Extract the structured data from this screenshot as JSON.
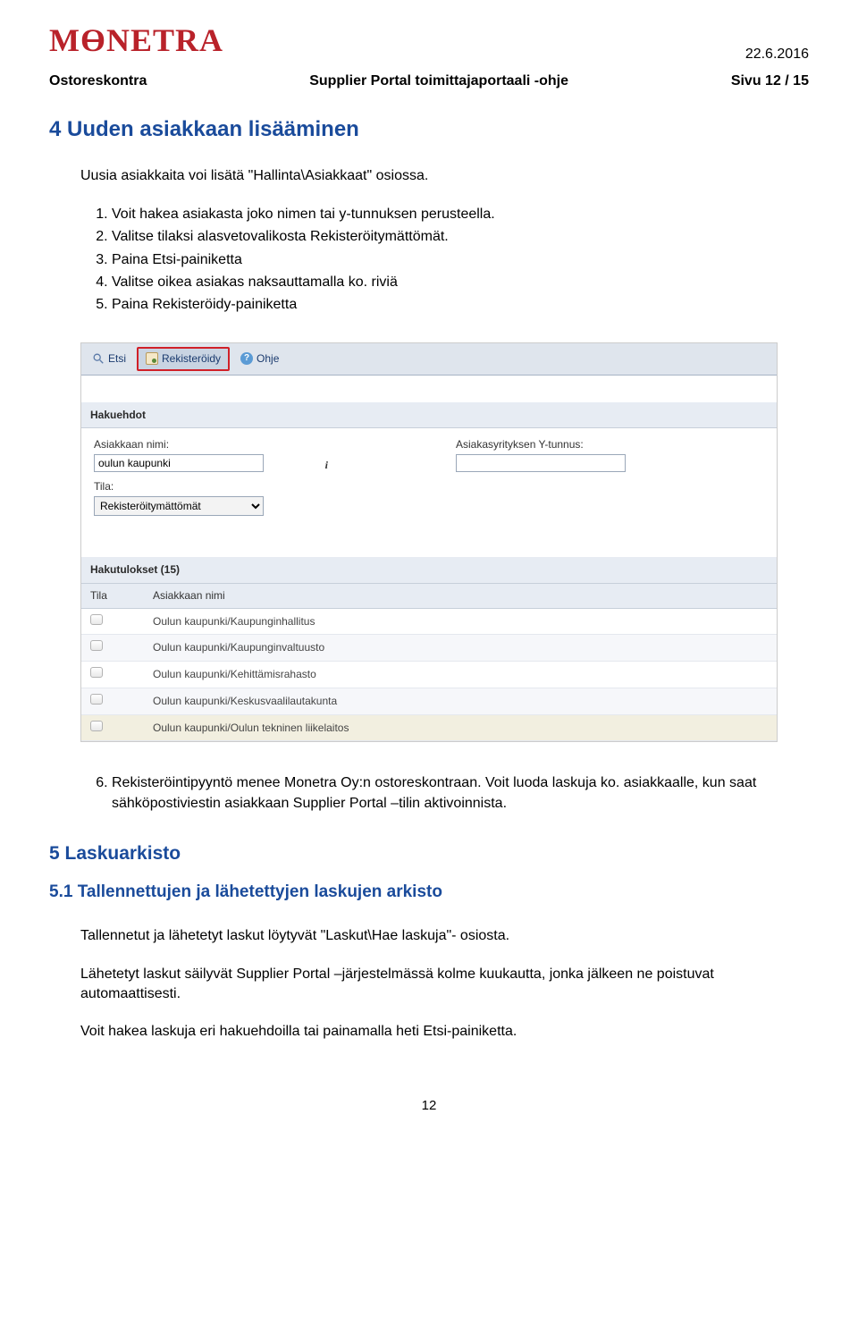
{
  "header": {
    "logo": "MONETRA",
    "date": "22.6.2016",
    "left": "Ostoreskontra",
    "center": "Supplier Portal toimittajaportaali -ohje",
    "right": "Sivu 12 / 15"
  },
  "sections": {
    "h1": "4 Uuden asiakkaan lisääminen",
    "intro": "Uusia asiakkaita voi lisätä \"Hallinta\\Asiakkaat\" osiossa.",
    "steps": {
      "1": "Voit hakea asiakasta joko nimen tai y-tunnuksen perusteella.",
      "2": "Valitse tilaksi alasvetovalikosta Rekisteröitymättömät.",
      "3": "Paina Etsi-painiketta",
      "4": "Valitse oikea asiakas naksauttamalla ko. riviä",
      "5": "Paina Rekisteröidy-painiketta"
    },
    "step6": "Rekisteröintipyyntö menee Monetra Oy:n ostoreskontraan. Voit luoda laskuja ko. asiakkaalle, kun saat sähköpostiviestin asiakkaan Supplier Portal –tilin aktivoinnista.",
    "h2": "5 Laskuarkisto",
    "h3": "5.1 Tallennettujen ja lähetettyjen laskujen arkisto",
    "p2": "Tallennetut ja lähetetyt laskut löytyvät \"Laskut\\Hae laskuja\"- osiosta.",
    "p3": "Lähetetyt laskut säilyvät Supplier Portal –järjestelmässä kolme kuukautta, jonka jälkeen ne poistuvat automaattisesti.",
    "p4": "Voit hakea laskuja eri hakuehdoilla tai painamalla heti Etsi-painiketta."
  },
  "screenshot": {
    "toolbar": {
      "etsi": "Etsi",
      "rekisteroidy": "Rekisteröidy",
      "ohje": "Ohje"
    },
    "section_hakuehdot": "Hakuehdot",
    "fields": {
      "asiakkaan_nimi_label": "Asiakkaan nimi:",
      "asiakkaan_nimi_value": "oulun kaupunki",
      "ytunnus_label": "Asiakasyrityksen Y-tunnus:",
      "ytunnus_value": "",
      "tila_label": "Tila:",
      "tila_value": "Rekisteröitymättömät"
    },
    "section_hakutulokset": "Hakutulokset (15)",
    "columns": {
      "tila": "Tila",
      "asiakkaan_nimi": "Asiakkaan nimi"
    },
    "rows": {
      "0": "Oulun kaupunki/Kaupunginhallitus",
      "1": "Oulun kaupunki/Kaupunginvaltuusto",
      "2": "Oulun kaupunki/Kehittämisrahasto",
      "3": "Oulun kaupunki/Keskusvaalilautakunta",
      "4": "Oulun kaupunki/Oulun tekninen liikelaitos"
    }
  },
  "page_num": "12"
}
